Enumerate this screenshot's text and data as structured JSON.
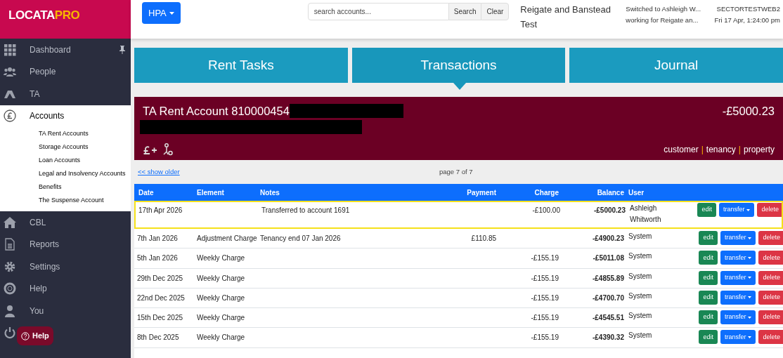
{
  "logo": {
    "left": "LOCATA",
    "right": "PRO"
  },
  "sidebar": {
    "items": [
      {
        "label": "Dashboard",
        "selected": false
      },
      {
        "label": "People",
        "selected": false
      },
      {
        "label": "TA",
        "selected": false
      },
      {
        "label": "Accounts",
        "selected": true,
        "children": [
          {
            "label": "TA Rent Accounts"
          },
          {
            "label": "Storage Accounts"
          },
          {
            "label": "Loan Accounts"
          },
          {
            "label": "Legal and Insolvency Accounts"
          },
          {
            "label": "Benefits"
          },
          {
            "label": "The Suspense Account"
          }
        ]
      },
      {
        "label": "CBL",
        "selected": false
      },
      {
        "label": "Reports",
        "selected": false
      },
      {
        "label": "Settings",
        "selected": false
      },
      {
        "label": "Help",
        "selected": false
      },
      {
        "label": "You",
        "selected": false
      }
    ]
  },
  "help_button": "Help",
  "topbar": {
    "org_button": "HPA",
    "search": {
      "placeholder": "search accounts...",
      "button": "Search",
      "clear": "Clear"
    },
    "org": "Reigate and Banstead Test",
    "status": [
      "Switched to Ashleigh W...",
      "working for Reigate an..."
    ],
    "server": "SECTORTESTWEB2",
    "datetime": "Fri 17 Apr, 1:24:00 pm"
  },
  "tabs": [
    {
      "label": "Rent Tasks",
      "selected": false
    },
    {
      "label": "Transactions",
      "selected": true
    },
    {
      "label": "Journal",
      "selected": false
    }
  ],
  "account": {
    "title": "TA Rent Account 810000454",
    "balance": "-£5000.23",
    "links": [
      {
        "label": "customer"
      },
      {
        "separator": "|",
        "label": "tenancy"
      },
      {
        "separator": "|",
        "label": "property"
      }
    ]
  },
  "pager": {
    "older": "<< show older",
    "page": "page 7 of 7"
  },
  "table": {
    "columns": [
      "Date",
      "Element",
      "Notes",
      "Payment",
      "Charge",
      "Balance",
      "User"
    ],
    "rows": [
      {
        "date": "17th Apr 2026",
        "element": "",
        "notes": "Transferred to account 1691",
        "payment": "",
        "charge": "-£100.00",
        "balance": "-£5000.23",
        "user": "Ashleigh Whitworth",
        "selected": true,
        "actions": [
          "edit",
          "transfer",
          "delete"
        ]
      },
      {
        "date": "7th Jan 2026",
        "element": "Adjustment Charge",
        "notes": "Tenancy end 07 Jan 2026",
        "payment": "£110.85",
        "charge": "",
        "balance": "-£4900.23",
        "user": "System",
        "selected": false,
        "actions": [
          "edit",
          "transfer",
          "delete"
        ]
      },
      {
        "date": "5th Jan 2026",
        "element": "Weekly Charge",
        "notes": "",
        "payment": "",
        "charge": "-£155.19",
        "balance": "-£5011.08",
        "user": "System",
        "selected": false,
        "actions": [
          "edit",
          "transfer",
          "delete"
        ]
      },
      {
        "date": "29th Dec 2025",
        "element": "Weekly Charge",
        "notes": "",
        "payment": "",
        "charge": "-£155.19",
        "balance": "-£4855.89",
        "user": "System",
        "selected": false,
        "actions": [
          "edit",
          "transfer",
          "delete"
        ]
      },
      {
        "date": "22nd Dec 2025",
        "element": "Weekly Charge",
        "notes": "",
        "payment": "",
        "charge": "-£155.19",
        "balance": "-£4700.70",
        "user": "System",
        "selected": false,
        "actions": [
          "edit",
          "transfer",
          "delete"
        ]
      },
      {
        "date": "15th Dec 2025",
        "element": "Weekly Charge",
        "notes": "",
        "payment": "",
        "charge": "-£155.19",
        "balance": "-£4545.51",
        "user": "System",
        "selected": false,
        "actions": [
          "edit",
          "transfer",
          "delete"
        ]
      },
      {
        "date": "8th Dec 2025",
        "element": "Weekly Charge",
        "notes": "",
        "payment": "",
        "charge": "-£155.19",
        "balance": "-£4390.32",
        "user": "System",
        "selected": false,
        "actions": [
          "edit",
          "transfer",
          "delete"
        ]
      }
    ]
  }
}
